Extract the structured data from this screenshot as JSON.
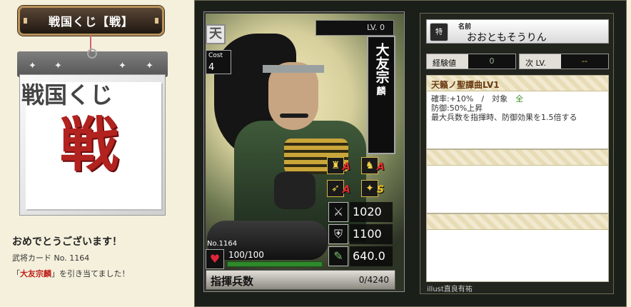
{
  "lottery": {
    "title": "戦国くじ【戦】",
    "pad_text_top": "戦国くじ",
    "pad_text_big": "戦"
  },
  "result": {
    "congrats": "おめでとうございます！",
    "card_number_line": "武将カード No. 1164",
    "drew_prefix": "「",
    "drew_name": "大友宗麟",
    "drew_suffix": "」を引き当てました！"
  },
  "card": {
    "rarity": "天",
    "cost_label": "Cost",
    "cost": "4",
    "level": "LV. 0",
    "name_big": "大友宗",
    "name_small": "麟",
    "number": "No.1164",
    "aptitudes": [
      {
        "icon": "spear-soldier-icon",
        "glyph": "♜",
        "grade": "A"
      },
      {
        "icon": "horse-cavalry-icon",
        "glyph": "♞",
        "grade": "A"
      },
      {
        "icon": "bow-archer-icon",
        "glyph": "➶",
        "grade": "A"
      },
      {
        "icon": "siege-weapon-icon",
        "glyph": "✦",
        "grade": "S"
      }
    ],
    "attack": "1020",
    "defense": "1100",
    "strategy": "640.0",
    "hp": "100/100",
    "hp_fraction": 1.0,
    "troops_label": "指揮兵数",
    "troops_value": "0/4240"
  },
  "info": {
    "seal": "特",
    "name_label": "名前",
    "name_value": "おおともそうりん",
    "exp_label": "経験値",
    "exp_value": "0",
    "next_label": "次 LV.",
    "next_value": "--",
    "skill": {
      "title": "天籟ノ聖譚曲LV1",
      "line1_pre": "確率:+10%　/　対象　",
      "line1_target": "全",
      "line2": "防御:50%上昇",
      "line3": "最大兵数を指揮時、防御効果を1.5倍する"
    },
    "illust": "illust直良有祐"
  }
}
